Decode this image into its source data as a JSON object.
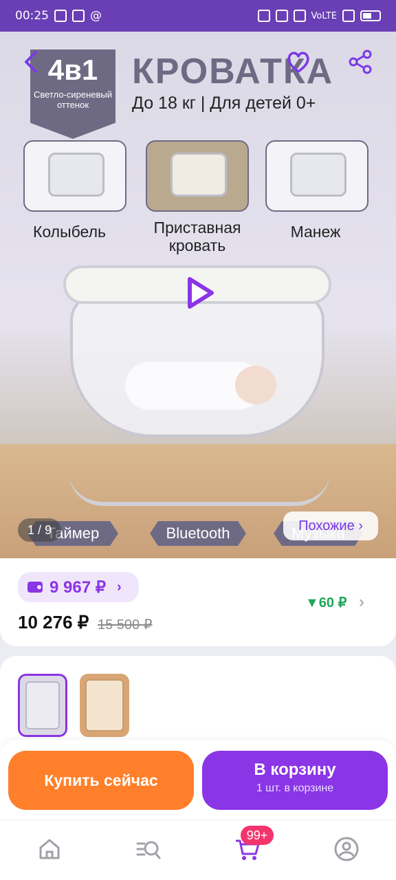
{
  "status_bar": {
    "time": "00:25",
    "right_text": "VoLTE"
  },
  "hero": {
    "badge_big": "4в1",
    "badge_small": "Светло-сиреневый оттенок",
    "title": "КРОВАТКА",
    "subtitle": "До 18 кг | Для детей 0+",
    "modes": [
      "Колыбель",
      "Приставная кровать",
      "Манеж"
    ],
    "features": [
      "Таймер",
      "Bluetooth",
      "Музыка"
    ],
    "counter": "1 / 9",
    "similar_label": "Похожие ›"
  },
  "price": {
    "wallet_price": "9 967 ₽",
    "current_price": "10 276 ₽",
    "old_price": "15 500 ₽",
    "bonus": "▼60 ₽"
  },
  "actions": {
    "buy_now": "Купить сейчас",
    "to_cart": "В корзину",
    "in_cart_note": "1 шт. в корзине"
  },
  "nav": {
    "cart_badge": "99+"
  },
  "colors": {
    "accent": "#8a35e6",
    "buy_now": "#ff7f2a",
    "status_bar": "#6a3fb5",
    "bonus_green": "#1fa65a",
    "badge_pink": "#f5336d"
  }
}
